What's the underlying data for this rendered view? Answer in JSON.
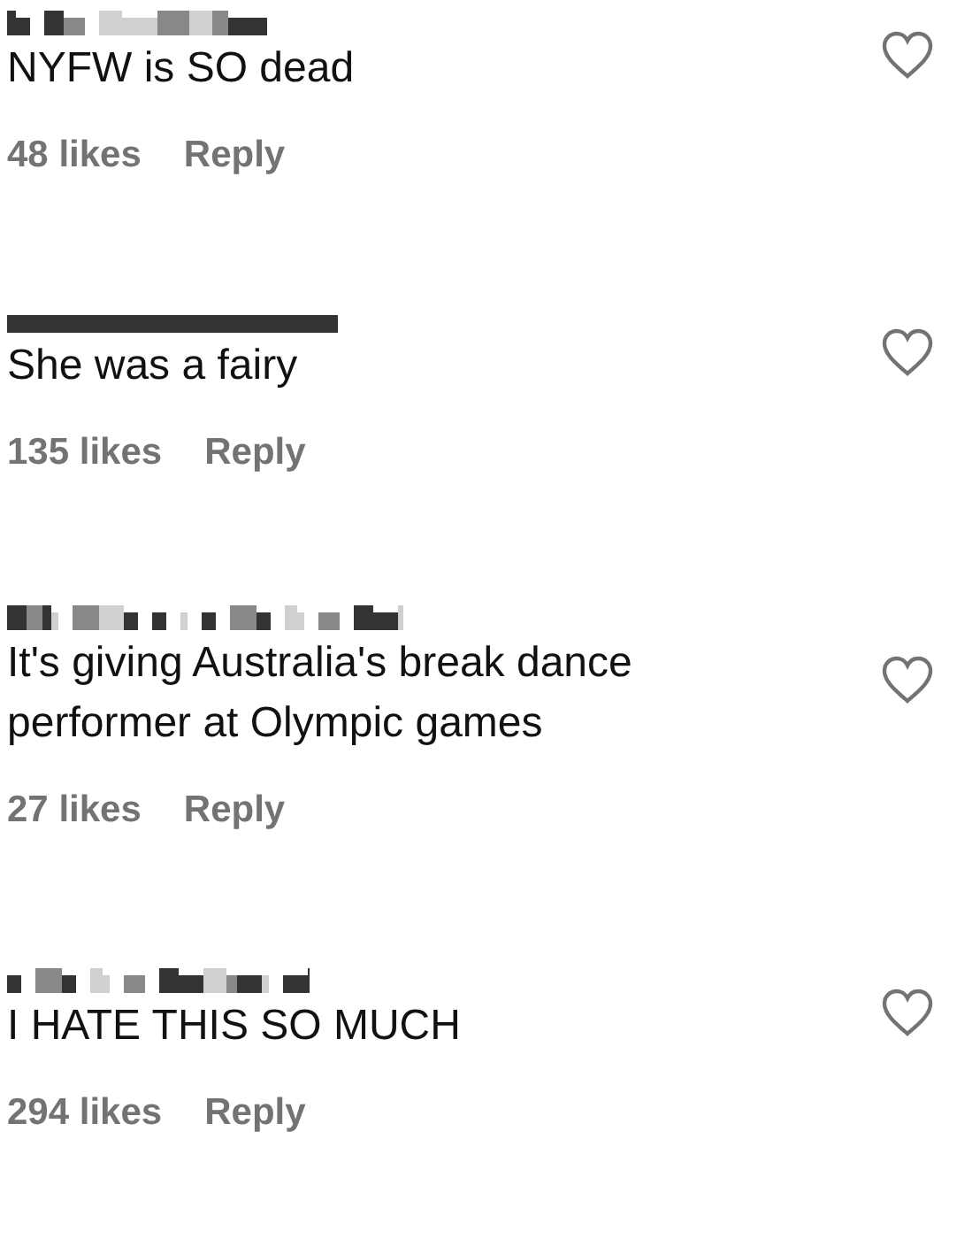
{
  "comments": [
    {
      "text": "NYFW is SO dead",
      "likes": "48 likes",
      "reply": "Reply",
      "liked": false
    },
    {
      "text": "She was a fairy",
      "likes": "135 likes",
      "reply": "Reply",
      "liked": false
    },
    {
      "text": "It's giving Australia's break dance performer at Olympic games",
      "likes": "27 likes",
      "reply": "Reply",
      "liked": false
    },
    {
      "text": "I HATE THIS SO MUCH",
      "likes": "294 likes",
      "reply": "Reply",
      "liked": false
    }
  ]
}
